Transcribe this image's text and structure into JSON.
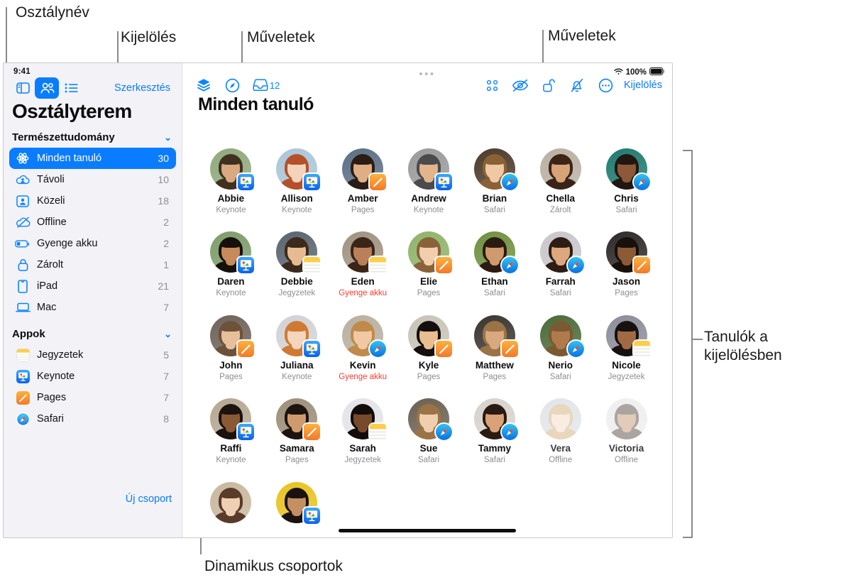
{
  "callouts": [
    {
      "id": "class-name",
      "text": "Osztálynév"
    },
    {
      "id": "selection",
      "text": "Kijelölés"
    },
    {
      "id": "actions-left",
      "text": "Műveletek"
    },
    {
      "id": "actions-right",
      "text": "Műveletek"
    },
    {
      "id": "students-in-selection",
      "text": "Tanulók a\nkijelölésben"
    },
    {
      "id": "dynamic-groups",
      "text": "Dinamikus csoportok"
    }
  ],
  "sidebar": {
    "status_time": "9:41",
    "edit_label": "Szerkesztés",
    "title": "Osztályterem",
    "class_name": "Természettudomány",
    "groups": [
      {
        "label": "Minden tanuló",
        "count": "30",
        "icon": "atom-icon",
        "selected": true
      },
      {
        "label": "Távoli",
        "count": "10",
        "icon": "cloud-person-icon",
        "selected": false
      },
      {
        "label": "Közeli",
        "count": "18",
        "icon": "person-frame-icon",
        "selected": false
      },
      {
        "label": "Offline",
        "count": "2",
        "icon": "cloud-slash-icon",
        "selected": false
      },
      {
        "label": "Gyenge akku",
        "count": "2",
        "icon": "battery-low-icon",
        "selected": false
      },
      {
        "label": "Zárolt",
        "count": "1",
        "icon": "lock-icon",
        "selected": false
      },
      {
        "label": "iPad",
        "count": "21",
        "icon": "ipad-icon",
        "selected": false
      },
      {
        "label": "Mac",
        "count": "7",
        "icon": "laptop-icon",
        "selected": false
      }
    ],
    "apps_header": "Appok",
    "apps": [
      {
        "label": "Jegyzetek",
        "count": "5",
        "icon": "notes-app-icon"
      },
      {
        "label": "Keynote",
        "count": "7",
        "icon": "keynote-app-icon"
      },
      {
        "label": "Pages",
        "count": "7",
        "icon": "pages-app-icon"
      },
      {
        "label": "Safari",
        "count": "8",
        "icon": "safari-app-icon"
      }
    ],
    "new_group_label": "Új csoport"
  },
  "main": {
    "title": "Minden tanuló",
    "inbox_count": "12",
    "select_label": "Kijelölés",
    "battery_text": "100%",
    "toolbar_left": [
      {
        "name": "layers-icon"
      },
      {
        "name": "navigate-icon"
      },
      {
        "name": "inbox-icon"
      }
    ],
    "toolbar_right": [
      {
        "name": "grid-view-icon"
      },
      {
        "name": "eye-slash-icon"
      },
      {
        "name": "lock-open-icon"
      },
      {
        "name": "bell-slash-icon"
      },
      {
        "name": "more-circle-icon"
      }
    ],
    "students": [
      {
        "name": "Abbie",
        "state": "Keynote",
        "badge": "keynote",
        "warn": false,
        "offline": false,
        "sky": "#8fa97c",
        "hair": "#40301f",
        "skin": "#d9a97f"
      },
      {
        "name": "Allison",
        "state": "Keynote",
        "badge": "keynote",
        "warn": false,
        "offline": false,
        "sky": "#a9c6d8",
        "hair": "#b4502a",
        "skin": "#f3d3bb"
      },
      {
        "name": "Amber",
        "state": "Pages",
        "badge": "pages",
        "warn": false,
        "offline": false,
        "sky": "#5b6f84",
        "hair": "#2b1d15",
        "skin": "#e0ae84"
      },
      {
        "name": "Andrew",
        "state": "Keynote",
        "badge": "keynote",
        "warn": false,
        "offline": false,
        "sky": "#9a9a9a",
        "hair": "#4a4a4f",
        "skin": "#e2b58c"
      },
      {
        "name": "Brian",
        "state": "Safari",
        "badge": "safari",
        "warn": false,
        "offline": false,
        "sky": "#4d3a2a",
        "hair": "#8a6137",
        "skin": "#f0c9a4"
      },
      {
        "name": "Chella",
        "state": "Zárolt",
        "badge": "none",
        "warn": false,
        "offline": false,
        "sky": "#b9b0a2",
        "hair": "#3a2418",
        "skin": "#d8a377"
      },
      {
        "name": "Chris",
        "state": "Safari",
        "badge": "safari",
        "warn": false,
        "offline": false,
        "sky": "#1f7a6e",
        "hair": "#221611",
        "skin": "#8c5a38"
      },
      {
        "name": "Daren",
        "state": "Keynote",
        "badge": "keynote",
        "warn": false,
        "offline": false,
        "sky": "#7d9c6a",
        "hair": "#16100c",
        "skin": "#c68a5c"
      },
      {
        "name": "Debbie",
        "state": "Jegyzetek",
        "badge": "notes",
        "warn": false,
        "offline": false,
        "sky": "#5a6470",
        "hair": "#3b2a1c",
        "skin": "#e6bb93"
      },
      {
        "name": "Eden",
        "state": "Gyenge akku",
        "badge": "notes",
        "warn": true,
        "offline": false,
        "sky": "#9f9381",
        "hair": "#3b2418",
        "skin": "#b98059"
      },
      {
        "name": "Elie",
        "state": "Pages",
        "badge": "pages",
        "warn": false,
        "offline": false,
        "sky": "#8fb36a",
        "hair": "#8a6239",
        "skin": "#f1cfae"
      },
      {
        "name": "Ethan",
        "state": "Safari",
        "badge": "safari",
        "warn": false,
        "offline": false,
        "sky": "#70903f",
        "hair": "#2a1a12",
        "skin": "#cf9a6c"
      },
      {
        "name": "Farrah",
        "state": "Safari",
        "badge": "safari",
        "warn": false,
        "offline": false,
        "sky": "#c9c6cc",
        "hair": "#2d1d14",
        "skin": "#dca87c"
      },
      {
        "name": "Jason",
        "state": "Pages",
        "badge": "pages",
        "warn": false,
        "offline": false,
        "sky": "#2c2a28",
        "hair": "#17100b",
        "skin": "#8b5a36"
      },
      {
        "name": "John",
        "state": "Pages",
        "badge": "pages",
        "warn": false,
        "offline": false,
        "sky": "#6f625a",
        "hair": "#6d523a",
        "skin": "#e8bf9b"
      },
      {
        "name": "Juliana",
        "state": "Keynote",
        "badge": "keynote",
        "warn": false,
        "offline": false,
        "sky": "#d2d2d6",
        "hair": "#cf7a33",
        "skin": "#f5d5bb"
      },
      {
        "name": "Kevin",
        "state": "Gyenge akku",
        "badge": "safari",
        "warn": true,
        "offline": false,
        "sky": "#b8b0a0",
        "hair": "#c08a4a",
        "skin": "#f0c8a2"
      },
      {
        "name": "Kyle",
        "state": "Pages",
        "badge": "pages",
        "warn": false,
        "offline": false,
        "sky": "#c8c3b8",
        "hair": "#140f0c",
        "skin": "#e8bd90"
      },
      {
        "name": "Matthew",
        "state": "Pages",
        "badge": "pages",
        "warn": false,
        "offline": false,
        "sky": "#3b3530",
        "hair": "#9a7346",
        "skin": "#d8a87e"
      },
      {
        "name": "Nerio",
        "state": "Safari",
        "badge": "safari",
        "warn": false,
        "offline": false,
        "sky": "#4a6b37",
        "hair": "#7a5a32",
        "skin": "#b07a4d"
      },
      {
        "name": "Nicole",
        "state": "Jegyzetek",
        "badge": "notes",
        "warn": false,
        "offline": false,
        "sky": "#8d8d9a",
        "hair": "#171110",
        "skin": "#a06a44"
      },
      {
        "name": "Raffi",
        "state": "Keynote",
        "badge": "keynote",
        "warn": false,
        "offline": false,
        "sky": "#b5a892",
        "hair": "#1b1310",
        "skin": "#8a5a36"
      },
      {
        "name": "Samara",
        "state": "Pages",
        "badge": "pages",
        "warn": false,
        "offline": false,
        "sky": "#9c8f79",
        "hair": "#1d1410",
        "skin": "#cf9b6e"
      },
      {
        "name": "Sarah",
        "state": "Jegyzetek",
        "badge": "notes",
        "warn": false,
        "offline": false,
        "sky": "#e3e3e8",
        "hair": "#120d0b",
        "skin": "#774a2c"
      },
      {
        "name": "Sue",
        "state": "Safari",
        "badge": "safari",
        "warn": false,
        "offline": false,
        "sky": "#6b6152",
        "hair": "#9a7346",
        "skin": "#f0cfb0"
      },
      {
        "name": "Tammy",
        "state": "Safari",
        "badge": "safari",
        "warn": false,
        "offline": false,
        "sky": "#d7d2cb",
        "hair": "#2a1a12",
        "skin": "#d9a279"
      },
      {
        "name": "Vera",
        "state": "Offline",
        "badge": "none",
        "warn": false,
        "offline": true,
        "sky": "#b9c3cc",
        "hair": "#c9a063",
        "skin": "#f3d6bb"
      },
      {
        "name": "Victoria",
        "state": "Offline",
        "badge": "none",
        "warn": false,
        "offline": true,
        "sky": "#d8d8dc",
        "hair": "#3a2b22",
        "skin": "#bb8459"
      },
      {
        "name": "",
        "state": "",
        "badge": "none",
        "warn": false,
        "offline": false,
        "sky": "#c9b79e",
        "hair": "#5a3a28",
        "skin": "#f0d0b4"
      },
      {
        "name": "",
        "state": "",
        "badge": "keynote",
        "warn": false,
        "offline": false,
        "sky": "#e8c320",
        "hair": "#1a1210",
        "skin": "#c48f63"
      }
    ]
  },
  "colors": {
    "accent": "#0a7cff",
    "sidebar_bg": "#f2f2f7",
    "warn": "#ff3b30",
    "secondary_text": "#8e8e93"
  }
}
